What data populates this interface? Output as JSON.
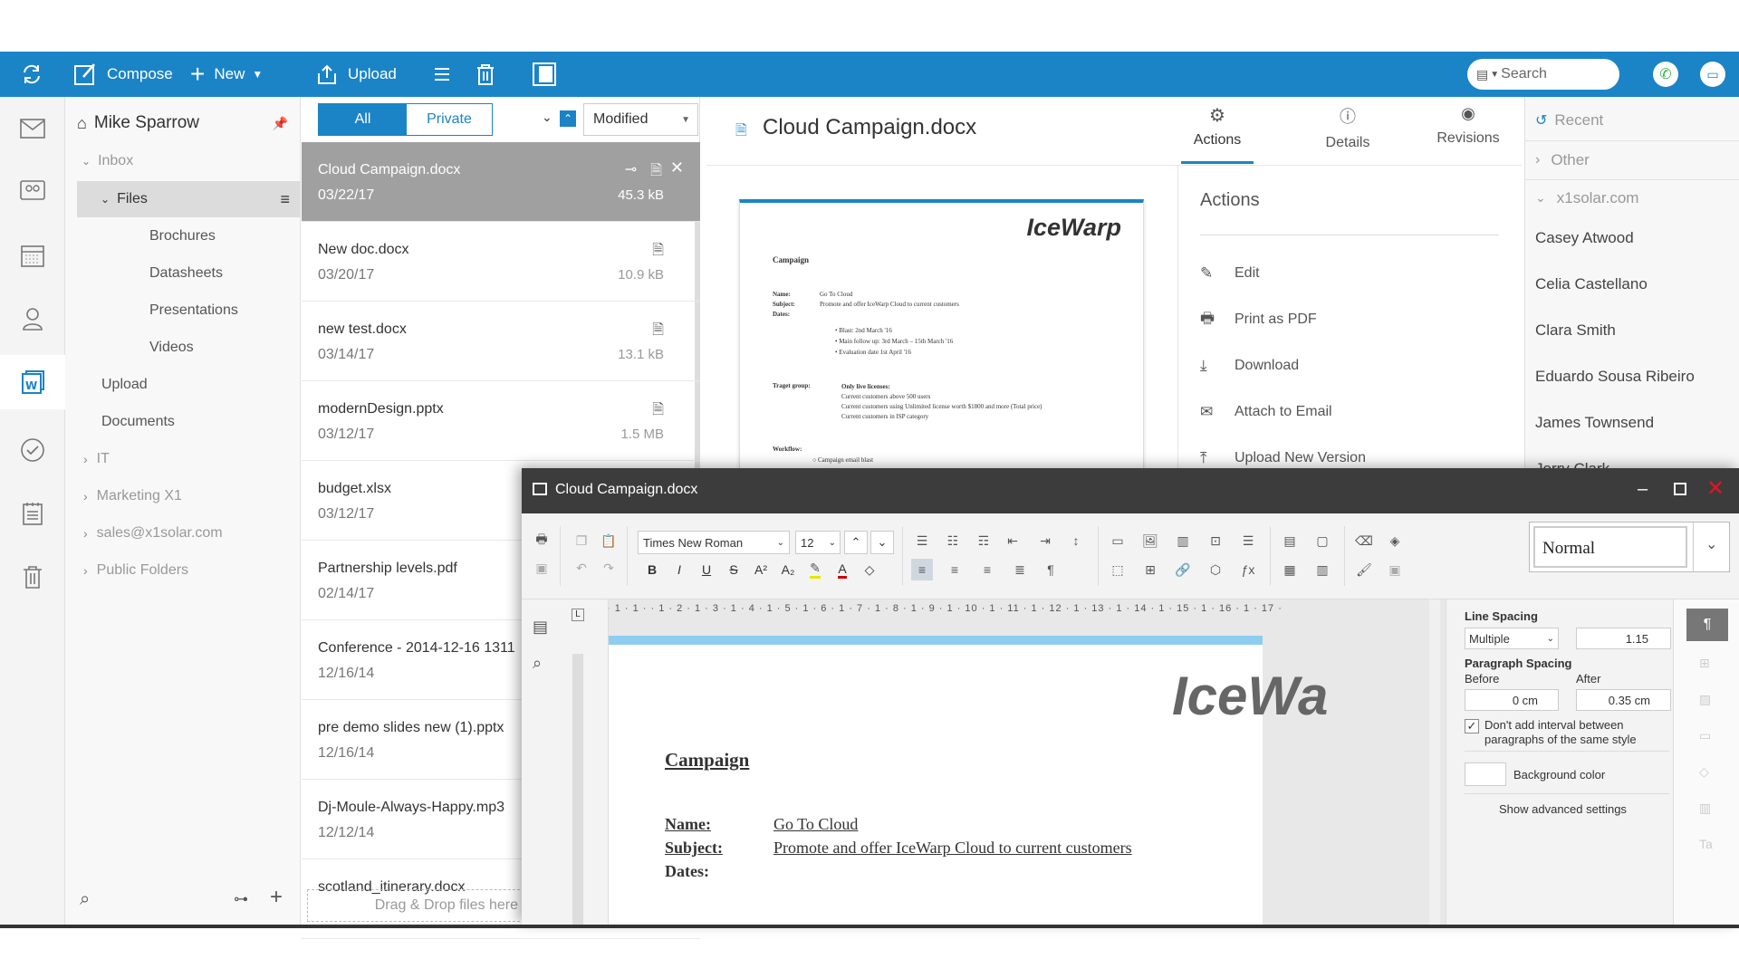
{
  "toolbar": {
    "compose": "Compose",
    "new": "New",
    "upload": "Upload",
    "search_placeholder": "Search"
  },
  "tree": {
    "user": "Mike Sparrow",
    "items": [
      "Inbox",
      "Files",
      "Brochures",
      "Datasheets",
      "Presentations",
      "Videos",
      "Upload",
      "Documents",
      "IT",
      "Marketing X1",
      "sales@x1solar.com",
      "Public Folders"
    ]
  },
  "filter": {
    "all": "All",
    "private": "Private",
    "sort": "Modified"
  },
  "files": [
    {
      "name": "Cloud Campaign.docx",
      "date": "03/22/17",
      "size": "45.3 kB"
    },
    {
      "name": "New doc.docx",
      "date": "03/20/17",
      "size": "10.9 kB"
    },
    {
      "name": "new test.docx",
      "date": "03/14/17",
      "size": "13.1 kB"
    },
    {
      "name": "modernDesign.pptx",
      "date": "03/12/17",
      "size": "1.5 MB"
    },
    {
      "name": "budget.xlsx",
      "date": "03/12/17",
      "size": ""
    },
    {
      "name": "Partnership levels.pdf",
      "date": "02/14/17",
      "size": ""
    },
    {
      "name": "Conference - 2014-12-16 1311",
      "date": "12/16/14",
      "size": ""
    },
    {
      "name": "pre demo slides new (1).pptx",
      "date": "12/16/14",
      "size": ""
    },
    {
      "name": "Dj-Moule-Always-Happy.mp3",
      "date": "12/12/14",
      "size": ""
    },
    {
      "name": "scotland_itinerary.docx",
      "date": "",
      "size": ""
    }
  ],
  "dropzone": "Drag & Drop files here",
  "preview": {
    "title": "Cloud Campaign.docx",
    "tabs": [
      "Actions",
      "Details",
      "Revisions"
    ],
    "doc": {
      "logo": "IceWarp",
      "heading": "Campaign",
      "name_k": "Name:",
      "name_v": "Go To Cloud",
      "subject_k": "Subject:",
      "subject_v": "Promote and offer IceWarp Cloud to current customers",
      "dates_k": "Dates:",
      "bullets": [
        "Blast: 2nd March '16",
        "Main follow up: 3rd March – 15th March '16",
        "Evaluation date 1st April '16"
      ],
      "target_k": "Traget group:",
      "target_v": "Only live licenses:",
      "target_lines": [
        "Current customers above 500 users",
        "Current customers using Unlimited license worth $1800 and more (Total price)",
        "Current customers in ISP category"
      ],
      "workflow_k": "Workflow:",
      "workflow_1": "Campaign email blast"
    }
  },
  "actions": {
    "heading": "Actions",
    "items": [
      "Edit",
      "Print as PDF",
      "Download",
      "Attach to Email",
      "Upload New Version"
    ]
  },
  "contacts": {
    "recent": "Recent",
    "other": "Other",
    "domain": "x1solar.com",
    "people": [
      "Casey Atwood",
      "Celia Castellano",
      "Clara Smith",
      "Eduardo Sousa Ribeiro",
      "James Townsend",
      "Jerry Clark"
    ]
  },
  "editor": {
    "title": "Cloud Campaign.docx",
    "font": "Times New Roman",
    "size": "12",
    "style": "Normal",
    "ruler": "· 1 · 1 · · 1 · 2 · 1 · 3 · 1 · 4 · 1 · 5 · 1 · 6 · 1 · 7 · 1 · 8 · 1 · 9 · 1 · 10 · 1 · 11 · 1 · 12 · 1 · 13 · 1 · 14 · 1 · 15 · 1 · 16 · 1 · 17 ·",
    "doc": {
      "logo": "IceWa",
      "heading": "Campaign",
      "name_k": "Name:",
      "name_v": "Go To Cloud",
      "subject_k": "Subject:",
      "subject_v": "Promote and offer IceWarp Cloud to current customers",
      "dates_k": "Dates:"
    },
    "panel": {
      "line_spacing": "Line Spacing",
      "ls_mode": "Multiple",
      "ls_value": "1.15",
      "para_spacing": "Paragraph Spacing",
      "before": "Before",
      "after": "After",
      "before_v": "0 cm",
      "after_v": "0.35 cm",
      "checkbox": "Don't add interval between paragraphs of the same style",
      "bg_color": "Background color",
      "advanced": "Show advanced settings"
    }
  },
  "colors": {
    "accent": "#1a84c7",
    "selected_row": "#a0a0a0",
    "titlebar": "#3c3c3c",
    "close": "#e81123"
  }
}
